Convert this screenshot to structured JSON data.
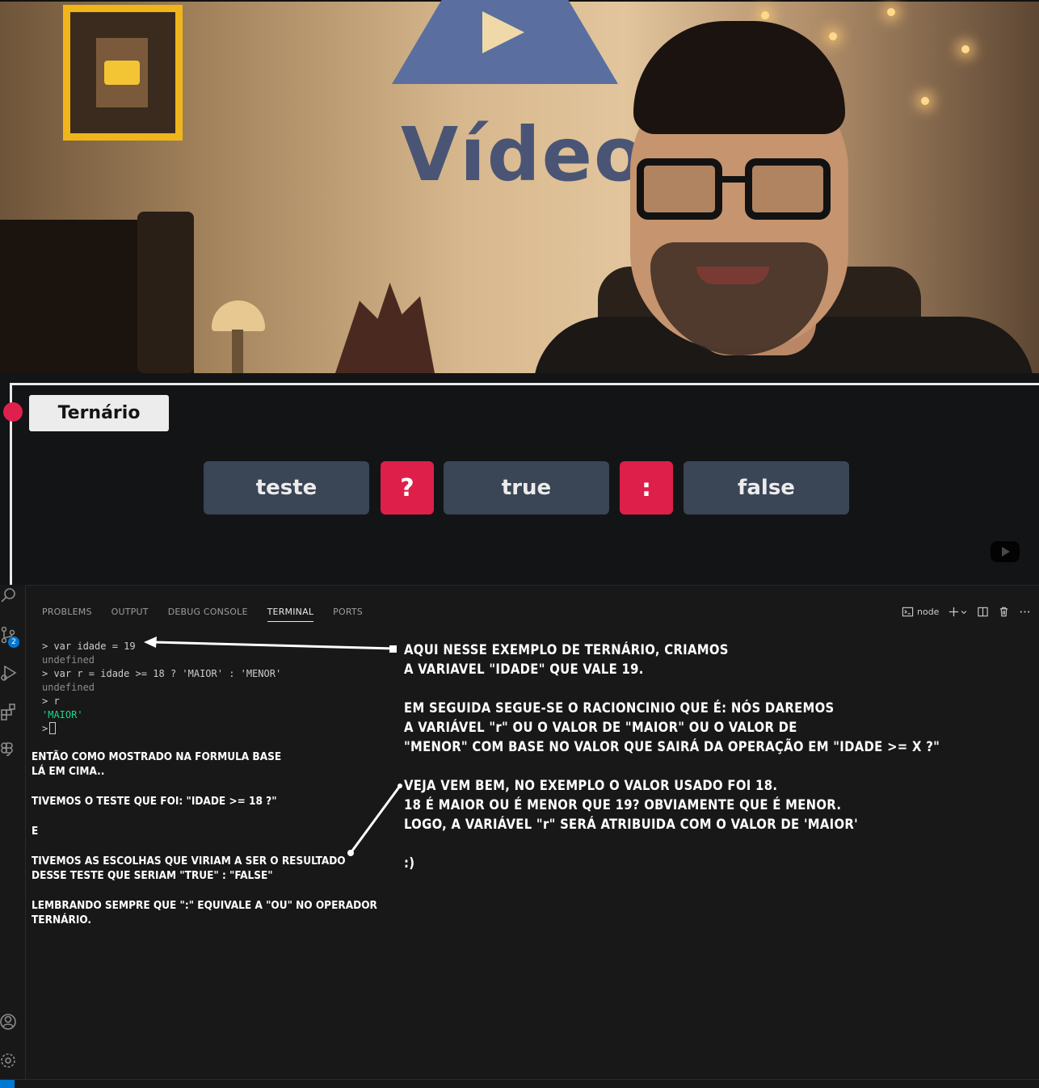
{
  "video": {
    "logo_text": "Vídeo"
  },
  "slide": {
    "title": "Ternário",
    "tokens": [
      "teste",
      "?",
      "true",
      ":",
      "false"
    ]
  },
  "panel": {
    "tabs": [
      "PROBLEMS",
      "OUTPUT",
      "DEBUG CONSOLE",
      "TERMINAL",
      "PORTS"
    ],
    "active_tab": "TERMINAL",
    "terminal_profile": "node",
    "activity_badge": "2"
  },
  "terminal": {
    "lines": [
      {
        "text": "> var idade = 19",
        "style": "normal"
      },
      {
        "text": "undefined",
        "style": "muted"
      },
      {
        "text": "> var r = idade >= 18 ? 'MAIOR' : 'MENOR'",
        "style": "normal"
      },
      {
        "text": "undefined",
        "style": "muted"
      },
      {
        "text": "> r",
        "style": "normal"
      },
      {
        "text": "'MAIOR'",
        "style": "green"
      }
    ],
    "prompt": ">"
  },
  "notes": {
    "left": "ENTÃO COMO MOSTRADO NA FORMULA BASE\nLÁ EM CIMA..\n\nTIVEMOS O TESTE QUE FOI: \"IDADE  >= 18 ?\"\n\nE\n\nTIVEMOS AS ESCOLHAS QUE VIRIAM A SER O RESULTADO\nDESSE TESTE QUE SERIAM \"TRUE\" : \"FALSE\"\n\nLEMBRANDO SEMPRE QUE \":\" EQUIVALE A \"OU\" NO OPERADOR\nTERNÁRIO.",
    "right": "AQUI NESSE EXEMPLO DE TERNÁRIO, CRIAMOS\nA VARIAVEL \"IDADE\" QUE VALE 19.\n\nEM SEGUIDA SEGUE-SE O RACIONCINIO QUE É: NÓS DAREMOS\nA VARIÁVEL \"r\" OU O VALOR DE \"MAIOR\" OU O VALOR DE\n\"MENOR\" COM  BASE NO VALOR QUE SAIRÁ DA OPERAÇÃO EM \"IDADE >=  X ?\"\n\nVEJA VEM BEM, NO EXEMPLO O VALOR USADO FOI 18.\n18 É MAIOR OU É MENOR QUE 19? OBVIAMENTE QUE É MENOR.\nLOGO, A VARIÁVEL \"r\" SERÁ ATRIBUIDA COM O VALOR DE 'MAIOR'\n\n:)"
  },
  "colors": {
    "accent_red": "#dd1f4a",
    "token_blue": "#3a4556",
    "vscode_bg": "#181818",
    "vscode_blue": "#0078d4"
  }
}
